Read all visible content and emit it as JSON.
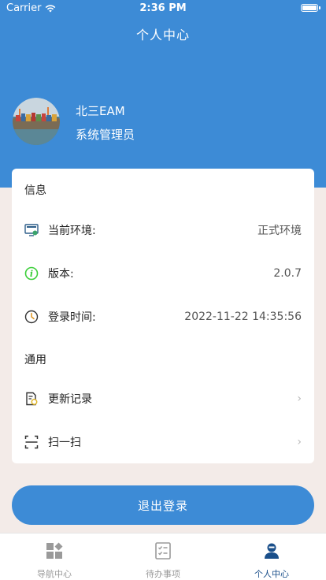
{
  "status_bar": {
    "carrier": "Carrier",
    "time": "2:36 PM"
  },
  "header": {
    "title": "个人中心"
  },
  "user": {
    "name": "北三EAM",
    "role": "系统管理员"
  },
  "info": {
    "section_title": "信息",
    "rows": [
      {
        "label": "当前环境:",
        "value": "正式环境",
        "icon": "environment-icon"
      },
      {
        "label": "版本:",
        "value": "2.0.7",
        "icon": "info-icon"
      },
      {
        "label": "登录时间:",
        "value": "2022-11-22 14:35:56",
        "icon": "clock-icon"
      }
    ]
  },
  "general": {
    "section_title": "通用",
    "rows": [
      {
        "label": "更新记录",
        "icon": "update-log-icon",
        "chevron": "›"
      },
      {
        "label": "扫一扫",
        "icon": "scan-icon",
        "chevron": "›"
      }
    ]
  },
  "logout": {
    "label": "退出登录"
  },
  "tabbar": {
    "tabs": [
      {
        "label": "导航中心",
        "icon": "grid-icon",
        "active": false
      },
      {
        "label": "待办事项",
        "icon": "checklist-icon",
        "active": false
      },
      {
        "label": "个人中心",
        "icon": "person-icon",
        "active": true
      }
    ]
  },
  "colors": {
    "primary": "#3d8bd6",
    "active_tab": "#1a4f8a",
    "background": "#f3ebe8"
  }
}
